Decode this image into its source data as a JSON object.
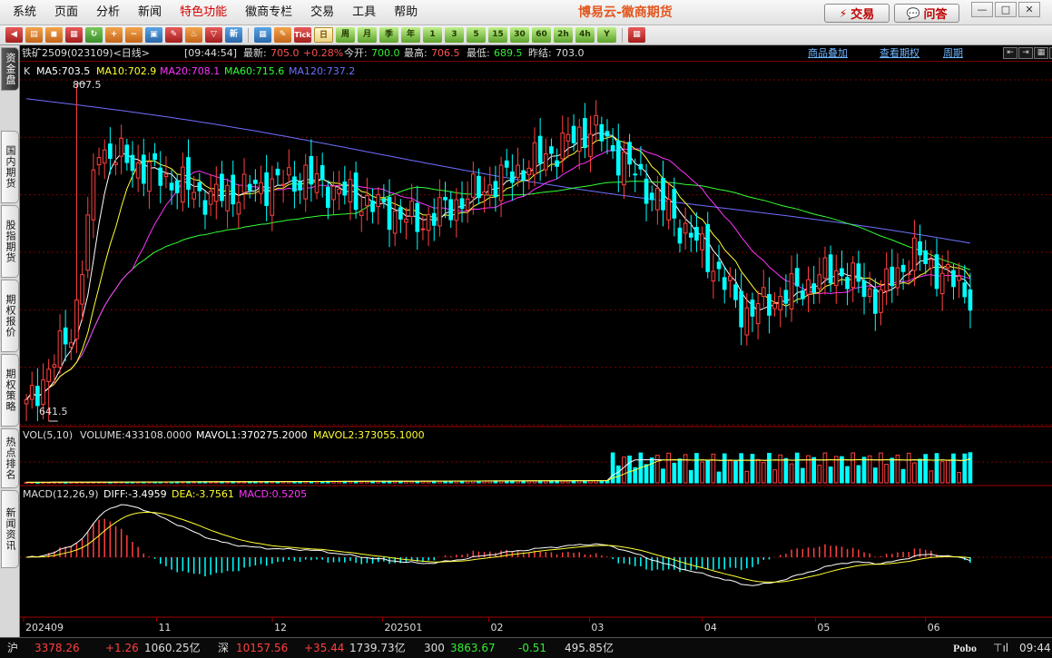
{
  "menu": [
    "系统",
    "页面",
    "分析",
    "新闻",
    "特色功能",
    "徽商专栏",
    "交易",
    "工具",
    "帮助"
  ],
  "brand": "博易云-徽商期货",
  "buttons": {
    "trade": "交易",
    "qa": "问答",
    "trade_icon": "⚡",
    "qa_icon": "💬"
  },
  "window_controls": [
    "—",
    "□",
    "✕"
  ],
  "toolbar": {
    "icons": [
      "back-icon",
      "open-icon",
      "save-icon",
      "print-icon",
      "refresh-icon",
      "zoom-in-icon",
      "zoom-out-icon",
      "indicator-icon",
      "pen-icon",
      "alert-icon",
      "filter-icon",
      "news-icon"
    ],
    "icon_labels": [
      "◀",
      "▤",
      "◼",
      "▦",
      "↻",
      "+",
      "−",
      "▣",
      "✎",
      "♨",
      "▽",
      "新"
    ],
    "periods": [
      "日",
      "周",
      "月",
      "季",
      "年",
      "1",
      "3",
      "5",
      "15",
      "30",
      "60",
      "2h",
      "4h",
      "Y"
    ],
    "tick_label": "Tick",
    "active_period": "日",
    "last_icon": "▦"
  },
  "sidebar": {
    "tabs": [
      "资金盘",
      "国内期货",
      "股指期货",
      "期权报价",
      "期权策略",
      "热点排名",
      "新闻资讯"
    ]
  },
  "quote": {
    "symbol": "铁矿2509(023109)<日线>",
    "time": "[09:44:54]",
    "last_label": "最新:",
    "last_value": "705.0",
    "change": "+0.28%",
    "open_label": "今开:",
    "open_value": "700.0",
    "high_label": "最高:",
    "high_value": "706.5",
    "low_label": "最低:",
    "low_value": "689.5",
    "prev_label": "昨结:",
    "prev_value": "703.0",
    "links": [
      "商品叠加",
      "查看期权",
      "周期"
    ]
  },
  "price_panel": {
    "k_label": "K",
    "ma": [
      {
        "label": "MA5:703.5",
        "color": "#ffffff"
      },
      {
        "label": "MA10:702.9",
        "color": "#ffff33"
      },
      {
        "label": "MA20:708.1",
        "color": "#ff33ff"
      },
      {
        "label": "MA60:715.6",
        "color": "#33ff33"
      },
      {
        "label": "MA120:737.2",
        "color": "#6f6fff"
      }
    ],
    "high_mark": "807.5",
    "low_mark": "641.5"
  },
  "volume_panel": {
    "title": "VOL(5,10)",
    "volume": "VOLUME:433108.0000",
    "mavol1": "MAVOL1:370275.2000",
    "mavol2": "MAVOL2:373055.1000"
  },
  "macd_panel": {
    "title": "MACD(12,26,9)",
    "diff": "DIFF:-3.4959",
    "dea": "DEA:-3.7561",
    "macd": "MACD:0.5205"
  },
  "x_axis": [
    "202409",
    "11",
    "12",
    "202501",
    "02",
    "03",
    "04",
    "05",
    "06"
  ],
  "status": {
    "sh_label": "沪",
    "sh_value": "3378.26",
    "sh_change": "+1.26",
    "sh_amount": "1060.25亿",
    "sz_label": "深",
    "sz_value": "10157.56",
    "sz_change": "+35.44",
    "sz_amount": "1739.73亿",
    "c300_label": "300",
    "c300_value": "3863.67",
    "c300_change": "-0.51",
    "c300_amount": "495.85亿",
    "logo": "Pobo",
    "time": "09:44"
  },
  "colors": {
    "up": "#ff4040",
    "down": "#00ffff",
    "ma5": "#ffffff",
    "ma10": "#ffff33",
    "ma20": "#ff33ff",
    "ma60": "#33ff33",
    "ma120": "#6f6fff",
    "grid": "#7a0000"
  },
  "chart_data": {
    "type": "candlestick",
    "price_range": [
      641.5,
      807.5
    ],
    "highest": 807.5,
    "lowest": 641.5,
    "last": 705.0,
    "x_labels": [
      "202409",
      "11",
      "12",
      "202501",
      "02",
      "03",
      "04",
      "05",
      "06"
    ],
    "ma_values": {
      "MA5": 703.5,
      "MA10": 702.9,
      "MA20": 708.1,
      "MA60": 715.6,
      "MA120": 737.2
    },
    "volume": 433108.0,
    "mavol1": 370275.2,
    "mavol2": 373055.1,
    "macd": {
      "diff": -3.4959,
      "dea": -3.7561,
      "macd": 0.5205
    }
  }
}
